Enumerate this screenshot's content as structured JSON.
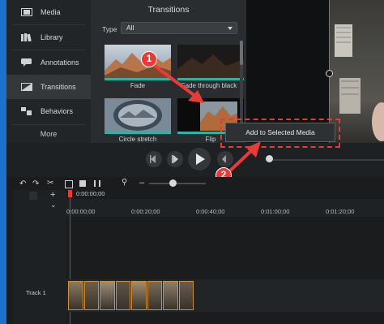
{
  "sidebar": {
    "items": [
      {
        "label": "Media",
        "icon": "film-icon"
      },
      {
        "label": "Library",
        "icon": "library-icon"
      },
      {
        "label": "Annotations",
        "icon": "speech-bubble-icon"
      },
      {
        "label": "Transitions",
        "icon": "transition-icon"
      },
      {
        "label": "Behaviors",
        "icon": "behaviors-icon"
      }
    ],
    "more_label": "More",
    "active_index": 3
  },
  "transitions": {
    "title": "Transitions",
    "type_label": "Type",
    "type_value": "All",
    "thumbs": [
      {
        "label": "Fade"
      },
      {
        "label": "Fade through black"
      },
      {
        "label": "Circle stretch"
      },
      {
        "label": "Flip"
      }
    ]
  },
  "context_menu": {
    "item": "Add to Selected Media"
  },
  "callouts": [
    "1",
    "2"
  ],
  "timeline": {
    "playhead_time": "0:00:00;00",
    "ticks": [
      "0:00:00;00",
      "0:00:20;00",
      "0:00:40;00",
      "0:01:00;00",
      "0:01:20;00"
    ],
    "track_label": "Track 1",
    "clip_count": 8
  },
  "colors": {
    "accent": "#1b73c9",
    "callout": "#e63b37",
    "clip_border": "#c98f3a"
  }
}
